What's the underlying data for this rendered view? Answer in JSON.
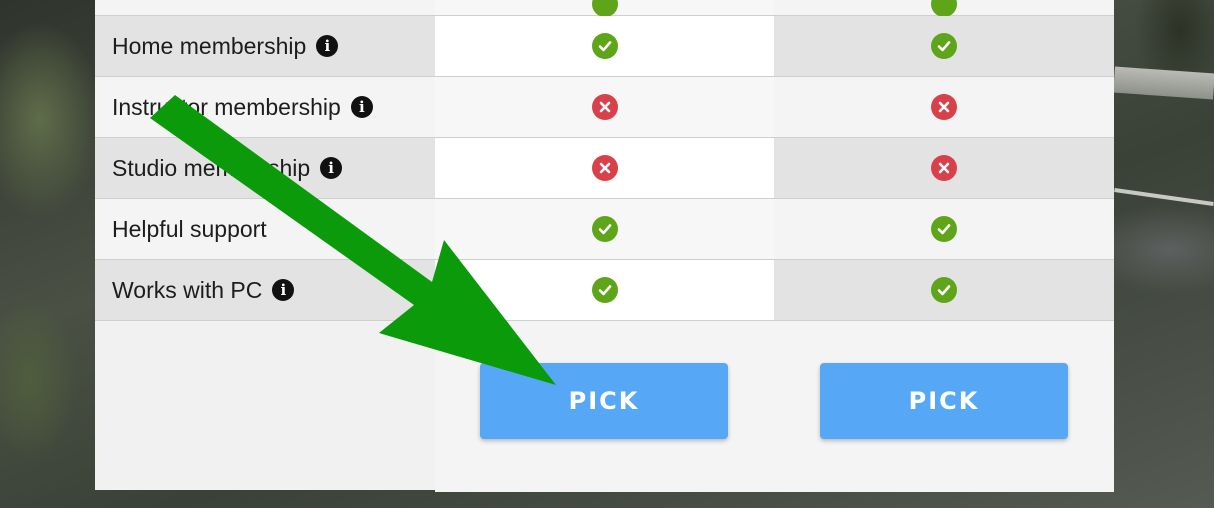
{
  "rows": [
    {
      "feature": "Home membership",
      "info": true,
      "plan1": "yes",
      "plan2": "yes"
    },
    {
      "feature": "Instructor membership",
      "info": true,
      "plan1": "no",
      "plan2": "no"
    },
    {
      "feature": "Studio membership",
      "info": true,
      "plan1": "no",
      "plan2": "no"
    },
    {
      "feature": "Helpful support",
      "info": false,
      "plan1": "yes",
      "plan2": "yes"
    },
    {
      "feature": "Works with PC",
      "info": true,
      "plan1": "yes",
      "plan2": "yes"
    }
  ],
  "buttons": {
    "pick1": "PICK",
    "pick2": "PICK"
  },
  "icons": {
    "info": "info-icon",
    "check": "check-circle-icon",
    "cross": "cross-circle-icon"
  },
  "colors": {
    "check": "#5ea51a",
    "cross": "#d9414a",
    "button": "#56a8f6",
    "arrow": "#0a9a0a"
  }
}
